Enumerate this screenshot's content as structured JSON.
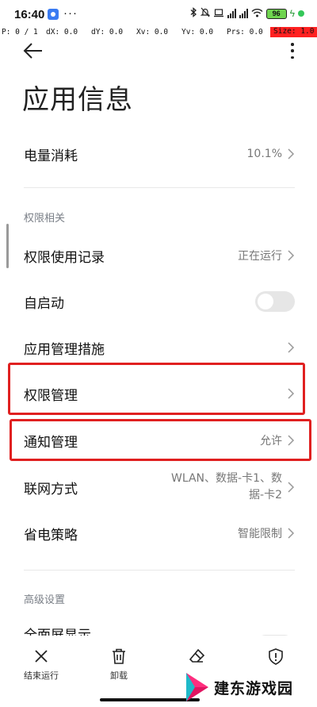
{
  "status_bar": {
    "time": "16:40",
    "dots": "···",
    "battery": "96"
  },
  "debug": {
    "p": "P: 0 / 1",
    "dx": "dX: 0.0",
    "dy": "dY: 0.0",
    "xv": "Xv: 0.0",
    "yv": "Yv: 0.0",
    "prs": "Prs: 0.0",
    "size": "Size: 1.0"
  },
  "header": {
    "title": "应用信息"
  },
  "battery_usage": {
    "label": "电量消耗",
    "value": "10.1%"
  },
  "permissions_section": {
    "header": "权限相关",
    "items": [
      {
        "label": "权限使用记录",
        "value": "正在运行"
      },
      {
        "label": "自启动",
        "toggle": "off"
      },
      {
        "label": "应用管理措施",
        "value": ""
      },
      {
        "label": "权限管理",
        "value": ""
      },
      {
        "label": "通知管理",
        "value": "允许"
      },
      {
        "label": "联网方式",
        "value_line1": "WLAN、数据-卡1、数",
        "value_line2": "据-卡2"
      },
      {
        "label": "省电策略",
        "value": "智能限制"
      }
    ]
  },
  "advanced_section": {
    "header": "高级设置",
    "items": [
      {
        "label": "全面屏显示"
      }
    ]
  },
  "bottom_actions": {
    "force_stop": "结束运行",
    "uninstall": "卸载",
    "clear_data": "",
    "permissions": ""
  },
  "watermark": {
    "text": "建东游戏园"
  },
  "colors": {
    "highlight": "#e02020",
    "secondary_text": "#777777",
    "section_header": "#7a7f87",
    "toggle_off": "#e6e6e6"
  }
}
